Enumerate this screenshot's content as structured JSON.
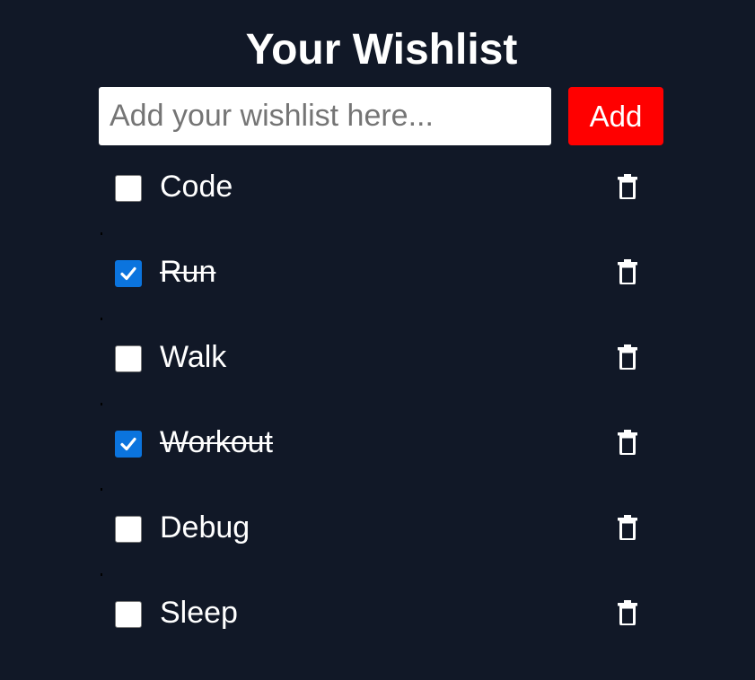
{
  "page": {
    "title": "Your Wishlist"
  },
  "form": {
    "input_placeholder": "Add your wishlist here...",
    "input_value": "",
    "add_label": "Add"
  },
  "items": [
    {
      "label": "Code",
      "checked": false
    },
    {
      "label": "Run",
      "checked": true
    },
    {
      "label": "Walk",
      "checked": false
    },
    {
      "label": "Workout",
      "checked": true
    },
    {
      "label": "Debug",
      "checked": false
    },
    {
      "label": "Sleep",
      "checked": false
    }
  ],
  "colors": {
    "background": "#111827",
    "add_button": "#ff0000",
    "checkbox_checked": "#0b74de"
  },
  "icons": {
    "checkbox_mark": "checkmark-icon",
    "delete": "trash-icon"
  }
}
